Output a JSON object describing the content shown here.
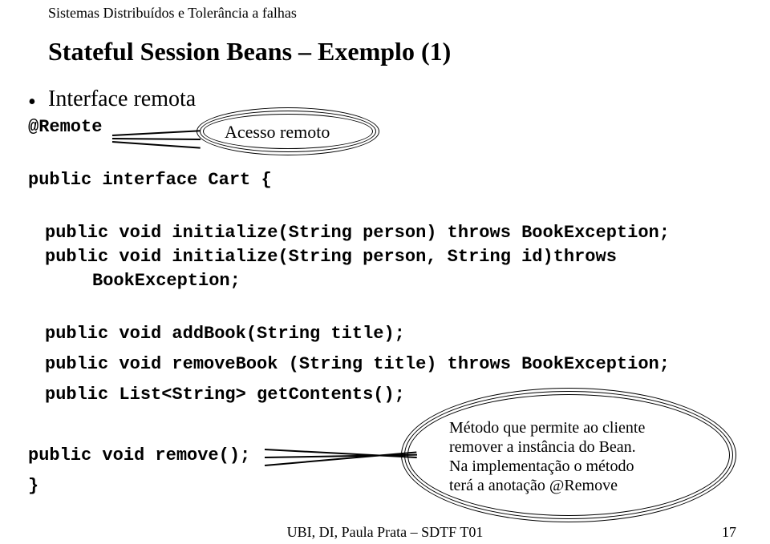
{
  "header": "Sistemas Distribuídos e Tolerância a falhas",
  "title": "Stateful Session Beans – Exemplo (1)",
  "bullet": "Interface remota",
  "callout1": "Acesso remoto",
  "code": {
    "remote": "@Remote",
    "iface": "public interface Cart {",
    "init1": "public void initialize(String person) throws BookException;",
    "init2a": "public void initialize(String person, String id)throws",
    "init2b": "BookException;",
    "addbook": "public void addBook(String title);",
    "removebook": "public void removeBook (String title) throws BookException;",
    "getcontents": "public List<String> getContents();",
    "removevoid": "public void remove();",
    "close": "}"
  },
  "callout2_line1": "Método que permite ao cliente",
  "callout2_line2": "remover a instância do Bean.",
  "callout2_line3": "Na implementação o método",
  "callout2_line4": "terá a anotação @Remove",
  "footer": "UBI, DI, Paula Prata – SDTF T01",
  "page": "17"
}
